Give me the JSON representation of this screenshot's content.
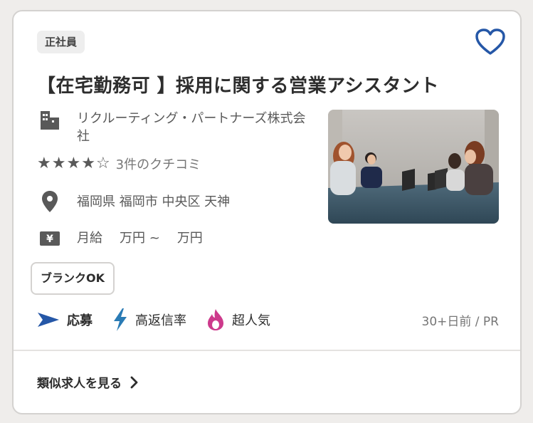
{
  "job": {
    "type_badge": "正社員",
    "title": "【在宅勤務可 】採用に関する営業アシスタント",
    "company": "リクルーティング・パートナーズ株式会社",
    "rating": {
      "stars": 4.5,
      "max": 5,
      "reviews_label": "3件のクチコミ"
    },
    "location": "福岡県 福岡市 中央区 天神",
    "salary": {
      "period": "月給",
      "min": "万円 ~",
      "max": "万円"
    },
    "tag": "ブランクOK",
    "features": [
      {
        "label": "応募",
        "icon": "send-arrow-icon",
        "color": "#2557a7"
      },
      {
        "label": "高返信率",
        "icon": "lightning-icon",
        "color": "#2a7bb5"
      },
      {
        "label": "超人気",
        "icon": "flame-icon",
        "color": "#cd3a8c"
      }
    ],
    "posted": "30+日前 / PR",
    "similar_link": "類似求人を見る"
  },
  "colors": {
    "heart": "#2557a7",
    "text": "#2d2d2d",
    "muted": "#595959"
  },
  "icons": {
    "company": "building-icon",
    "location": "map-pin-icon",
    "salary": "yen-icon",
    "save": "heart-icon",
    "chevron": "chevron-right-icon"
  }
}
